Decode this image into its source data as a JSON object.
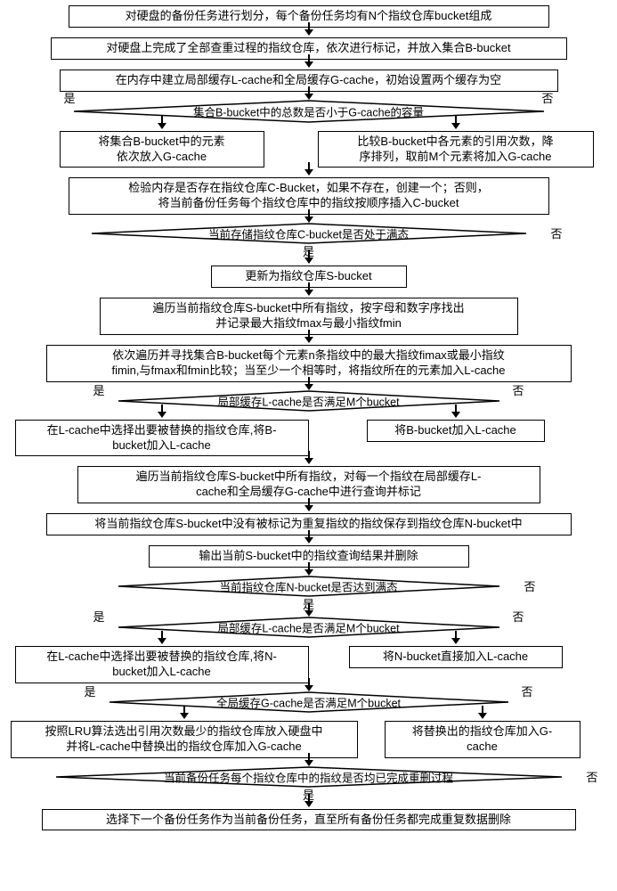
{
  "nodes": {
    "n1": "对硬盘的备份任务进行划分，每个备份任务均有N个指纹仓库bucket组成",
    "n2": "对硬盘上完成了全部查重过程的指纹仓库，依次进行标记，并放入集合B-bucket",
    "n3": "在内存中建立局部缓存L-cache和全局缓存G-cache，初始设置两个缓存为空",
    "d1": "集合B-bucket中的总数是否小于G-cache的容量",
    "n4a": "将集合B-bucket中的元素\n依次放入G-cache",
    "n4b": "比较B-bucket中各元素的引用次数，降\n序排列，取前M个元素将加入G-cache",
    "n5": "检验内存是否存在指纹仓库C-Bucket，如果不存在，创建一个；否则，\n将当前备份任务每个指纹仓库中的指纹按顺序插入C-bucket",
    "d2": "当前存储指纹仓库C-bucket是否处于满态",
    "n6": "更新为指纹仓库S-bucket",
    "n7": "遍历当前指纹仓库S-bucket中所有指纹，按字母和数字序找出\n并记录最大指纹fmax与最小指纹fmin",
    "n8": "依次遍历并寻找集合B-bucket每个元素n条指纹中的最大指纹fimax或最小指纹\nfimin,与fmax和fmin比较；当至少一个相等时，将指纹所在的元素加入L-cache",
    "d3": "局部缓存L-cache是否满足M个bucket",
    "n9a": "在L-cache中选择出要被替换的指纹仓库,将B-\nbucket加入L-cache",
    "n9b": "将B-bucket加入L-cache",
    "n10": "遍历当前指纹仓库S-bucket中所有指纹，对每一个指纹在局部缓存L-\ncache和全局缓存G-cache中进行查询并标记",
    "n11": "将当前指纹仓库S-bucket中没有被标记为重复指纹的指纹保存到指纹仓库N-bucket中",
    "n12": "输出当前S-bucket中的指纹查询结果并删除",
    "d4": "当前指纹仓库N-bucket是否达到满态",
    "d5": "局部缓存L-cache是否满足M个bucket",
    "n13a": "在L-cache中选择出要被替换的指纹仓库,将N-\nbucket加入L-cache",
    "n13b": "将N-bucket直接加入L-cache",
    "d6": "全局缓存G-cache是否满足M个bucket",
    "n14a": "按照LRU算法选出引用次数最少的指纹仓库放入硬盘中\n并将L-cache中替换出的指纹仓库加入G-cache",
    "n14b": "将替换出的指纹仓库加入G-\ncache",
    "d7": "当前备份任务每个指纹仓库中的指纹是否均已完成重删过程",
    "n15": "选择下一个备份任务作为当前备份任务，直至所有备份任务都完成重复数据删除"
  },
  "labels": {
    "yes": "是",
    "no": "否"
  }
}
